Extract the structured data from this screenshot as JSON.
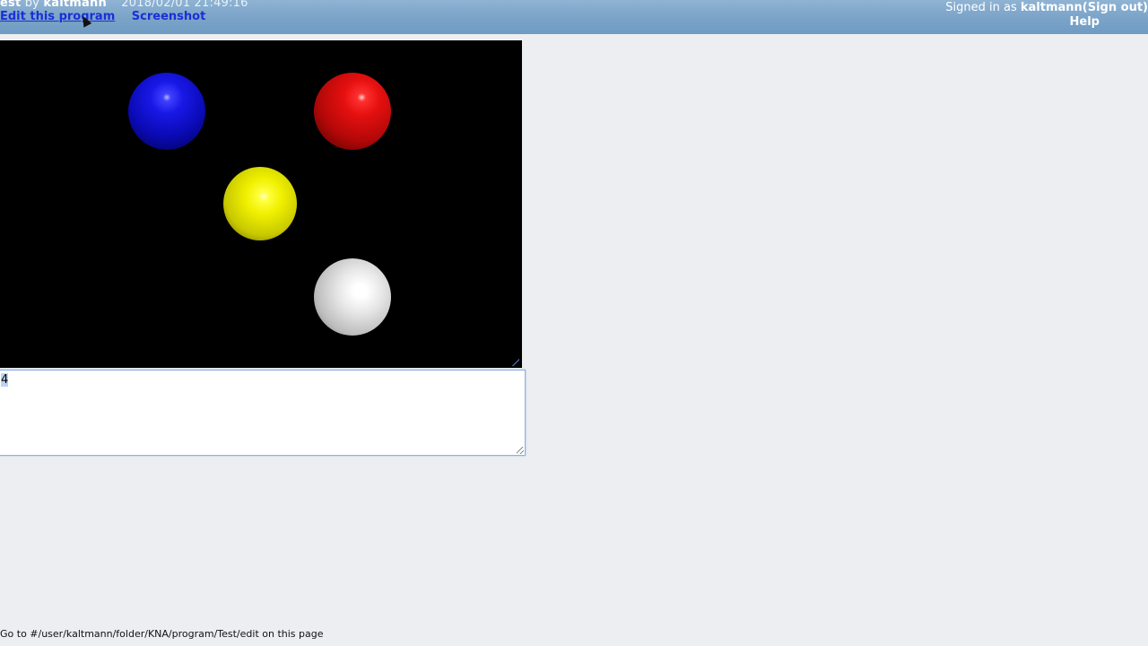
{
  "header": {
    "program_name": "est",
    "by_label": "by",
    "author": "kaltmann",
    "date": "2018/02/01 21:49:16",
    "edit_link": "Edit this program",
    "screenshot_link": "Screenshot",
    "signed_in_prefix": "Signed in as",
    "signed_in_user": "kaltmann",
    "sign_out": "(Sign out)",
    "help": "Help"
  },
  "canvas": {
    "balls": [
      {
        "color_name": "blue",
        "color": "#1818e6"
      },
      {
        "color_name": "red",
        "color": "#e61010"
      },
      {
        "color_name": "yellow",
        "color": "#f0f000"
      },
      {
        "color_name": "white",
        "color": "#e6e6e6"
      }
    ]
  },
  "output": {
    "value": "4"
  },
  "status_bar": {
    "text": "Go to #/user/kaltmann/folder/KNA/program/Test/edit on this page"
  },
  "colors": {
    "header_bg": "#7aa3c8",
    "link": "#1a2fd6",
    "page_bg": "#eceef2"
  }
}
